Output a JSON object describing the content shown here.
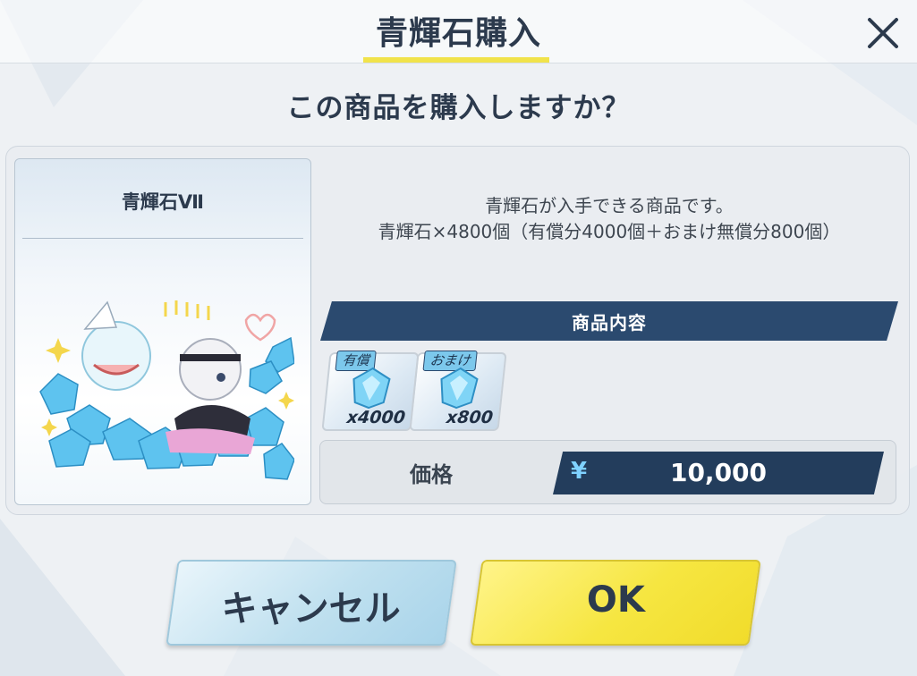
{
  "dialog": {
    "title": "青輝石購入",
    "close_icon": "close-icon",
    "question": "この商品を購入しますか？"
  },
  "product": {
    "name": "青輝石Ⅶ",
    "description_line1": "青輝石が入手できる商品です。",
    "description_line2": "青輝石×4800個（有償分4000個＋おまけ無償分800個）",
    "contents_label": "商品内容",
    "items": [
      {
        "tag": "有償",
        "quantity": "x4000",
        "icon": "gem-icon"
      },
      {
        "tag": "おまけ",
        "quantity": "x800",
        "icon": "gem-icon"
      }
    ],
    "price_label": "価格",
    "currency_symbol": "¥",
    "price": "10,000"
  },
  "buttons": {
    "cancel": "キャンセル",
    "ok": "OK"
  },
  "colors": {
    "title_text": "#2c3a4d",
    "accent_yellow": "#f1e34a",
    "navy": "#233d5c",
    "cancel_blue": "#bfe0ef",
    "ok_yellow": "#f6e641"
  }
}
